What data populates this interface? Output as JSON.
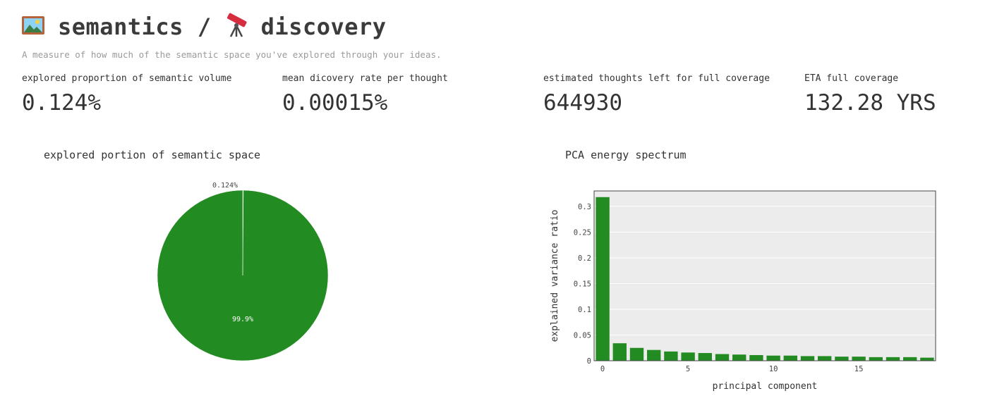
{
  "header": {
    "icon_left": "framed-picture-icon",
    "title_a": "semantics",
    "separator": "/",
    "icon_right": "telescope-icon",
    "title_b": "discovery",
    "subtitle": "A measure of how much of the semantic space you've explored through your ideas."
  },
  "metrics": [
    {
      "label": "explored proportion of semantic volume",
      "value": "0.124%"
    },
    {
      "label": "mean dicovery rate per thought",
      "value": "0.00015%"
    },
    {
      "label": "estimated thoughts left for full coverage",
      "value": "644930"
    },
    {
      "label": "ETA full coverage",
      "value": "132.28 YRS"
    }
  ],
  "colors": {
    "bar": "#228b22",
    "pie_main": "#228b22",
    "pie_small": "#3cb043",
    "plot_bg": "#ececec",
    "grid": "#ffffff"
  },
  "chart_data": [
    {
      "type": "pie",
      "title": "explored portion of semantic space",
      "slices": [
        {
          "value": 0.124,
          "label": "0.124%"
        },
        {
          "value": 99.876,
          "label": "99.9%"
        }
      ]
    },
    {
      "type": "bar",
      "title": "PCA energy spectrum",
      "xlabel": "principal component",
      "ylabel": "explained variance ratio",
      "x": [
        0,
        1,
        2,
        3,
        4,
        5,
        6,
        7,
        8,
        9,
        10,
        11,
        12,
        13,
        14,
        15,
        16,
        17,
        18,
        19
      ],
      "values": [
        0.318,
        0.034,
        0.025,
        0.021,
        0.018,
        0.016,
        0.015,
        0.013,
        0.012,
        0.011,
        0.01,
        0.01,
        0.009,
        0.009,
        0.008,
        0.008,
        0.007,
        0.007,
        0.007,
        0.006
      ],
      "xticks": [
        0,
        5,
        10,
        15
      ],
      "yticks": [
        0,
        0.05,
        0.1,
        0.15,
        0.2,
        0.25,
        0.3
      ],
      "ylim": [
        0,
        0.33
      ],
      "xlim": [
        -0.5,
        19.5
      ],
      "grid": true
    }
  ]
}
